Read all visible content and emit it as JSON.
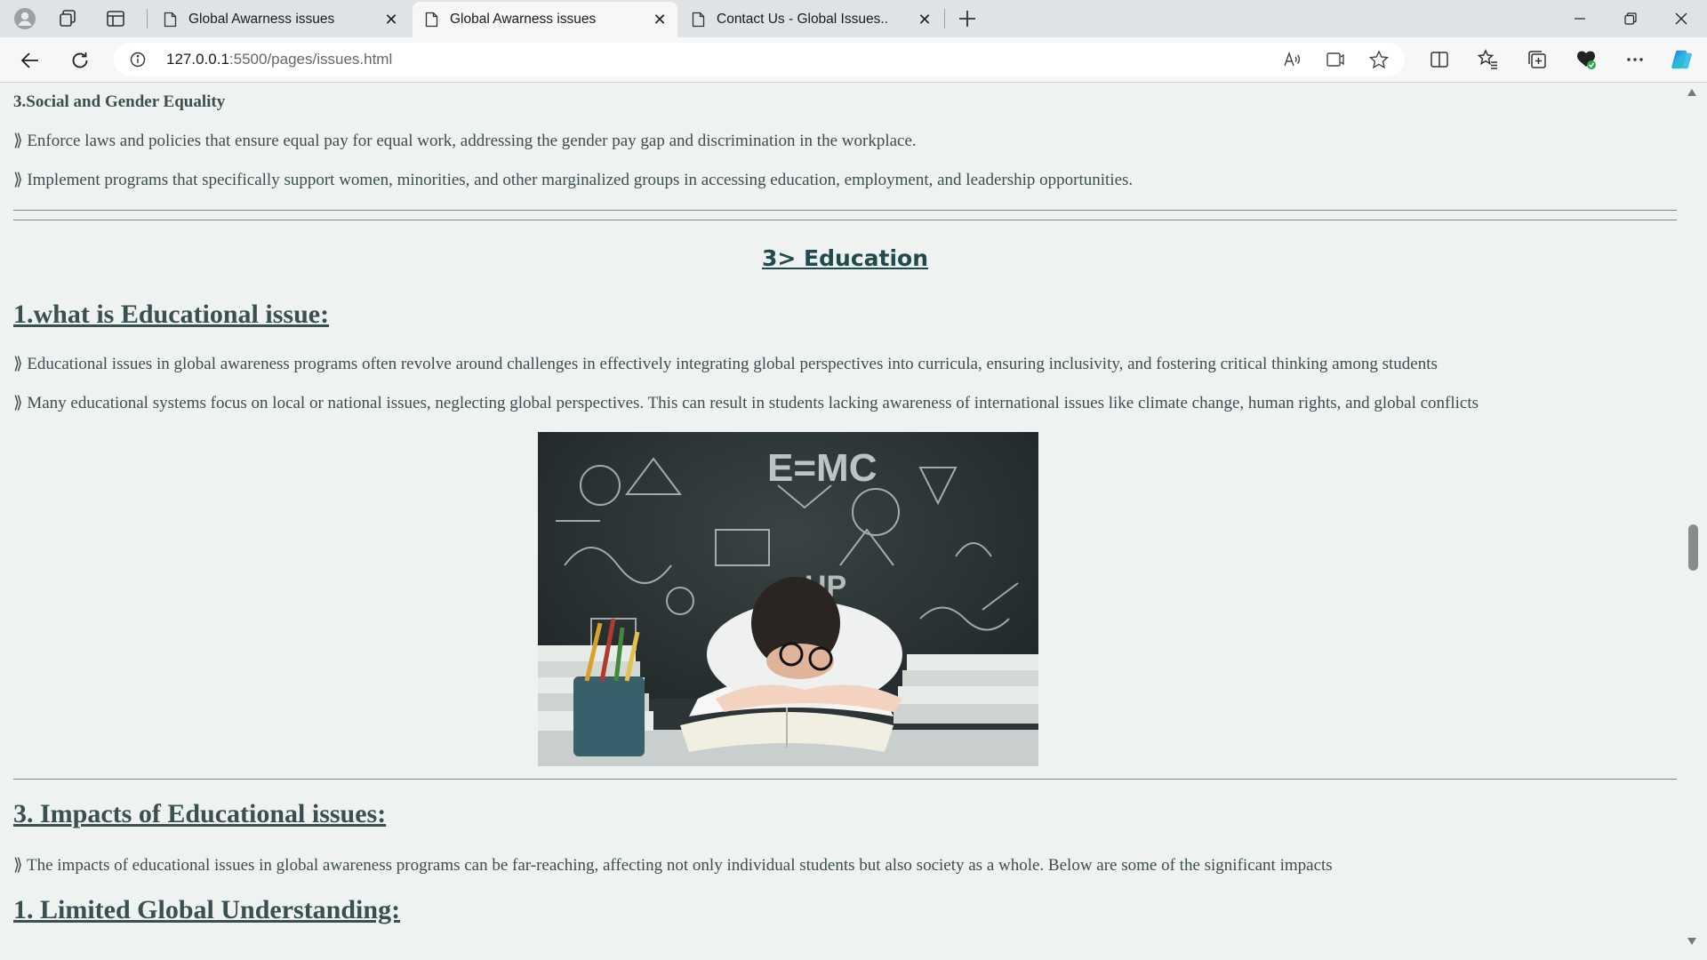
{
  "browser": {
    "tabs": [
      {
        "title": "Global Awarness issues",
        "active": false
      },
      {
        "title": "Global Awarness issues",
        "active": true
      },
      {
        "title": "Contact Us - Global Issues..",
        "active": false
      }
    ],
    "address": {
      "host": "127.0.0.1",
      "rest": ":5500/pages/issues.html"
    }
  },
  "page": {
    "subheading": "3.Social and Gender Equality",
    "equality_points": [
      "⟫ Enforce laws and policies that ensure equal pay for equal work, addressing the gender pay gap and discrimination in the workplace.",
      "⟫ Implement programs that specifically support women, minorities, and other marginalized groups in accessing education, employment, and leadership opportunities."
    ],
    "section_title": "3> Education",
    "edu_heading": "1.what is Educational issue:",
    "edu_points": [
      "⟫ Educational issues in global awareness programs often revolve around challenges in effectively integrating global perspectives into curricula, ensuring inclusivity, and fostering critical thinking among students",
      "⟫ Many educational systems focus on local or national issues, neglecting global perspectives. This can result in students lacking awareness of international issues like climate change, human rights, and global conflicts"
    ],
    "image_caption_text": "E=MC",
    "impacts_heading": "3. Impacts of Educational issues:",
    "impacts_point": "⟫ The impacts of educational issues in global awareness programs can be far-reaching, affecting not only individual students but also society as a whole. Below are some of the significant impacts",
    "limited_heading": "1. Limited Global Understanding:"
  },
  "colors": {
    "page_bg": "#eef2f1",
    "text": "#3d4e50",
    "section": "#1f4a4e"
  }
}
